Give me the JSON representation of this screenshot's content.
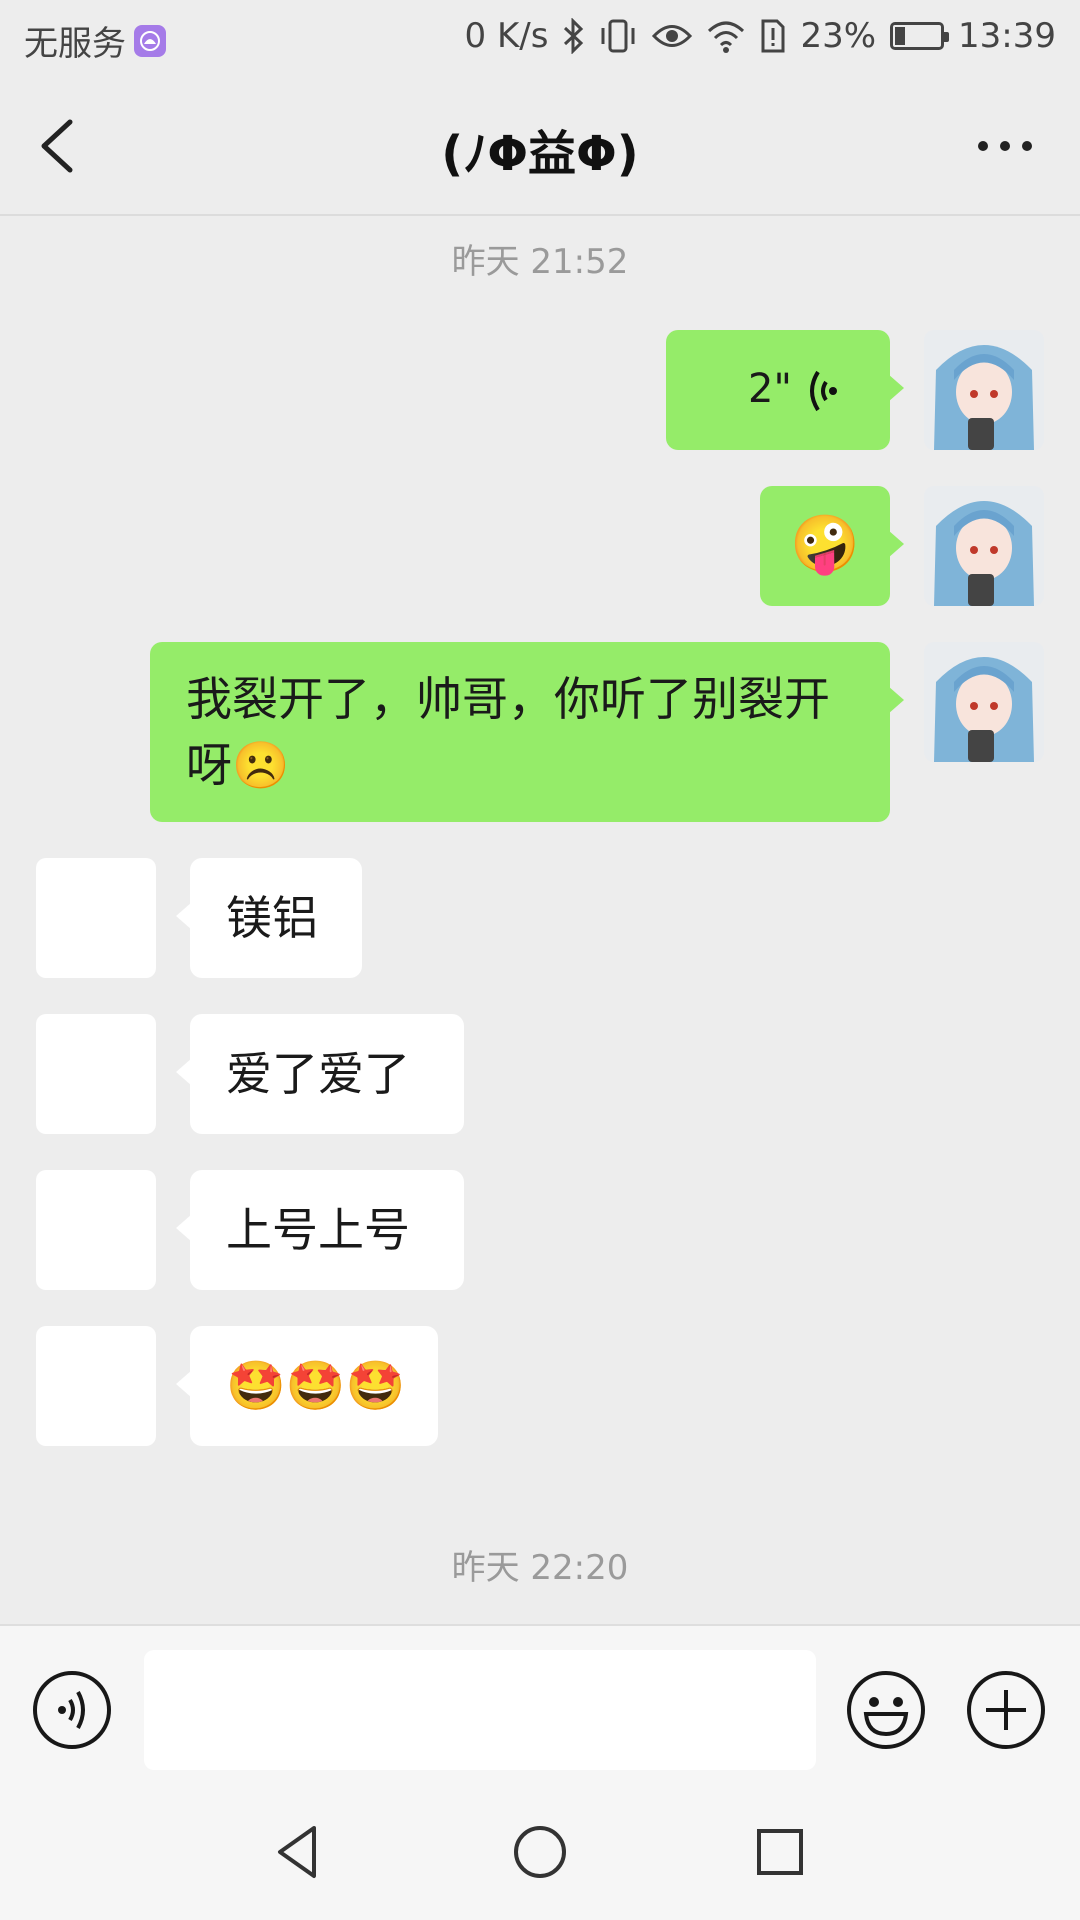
{
  "status_bar": {
    "carrier": "无服务",
    "net_speed": "0 K/s",
    "battery_percent": "23%",
    "battery_level": 0.23,
    "time": "13:39"
  },
  "header": {
    "title": "(ﾉΦ益Φ)"
  },
  "timestamps": [
    "昨天 21:52",
    "昨天 22:20"
  ],
  "messages": {
    "m1": {
      "type": "voice",
      "duration": "2\""
    },
    "m2": {
      "type": "emoji",
      "text": "🤪"
    },
    "m3": {
      "text": "我裂开了，帅哥，你听了别裂开呀☹️"
    },
    "m4": {
      "text": "镁铝"
    },
    "m5": {
      "text": "爱了爱了"
    },
    "m6": {
      "text": "上号上号"
    },
    "m7": {
      "text": "🤩🤩🤩"
    }
  },
  "input": {
    "value": "",
    "placeholder": ""
  },
  "icons": {
    "back": "back-arrow-icon",
    "more": "more-dots-icon",
    "voice": "voice-input-icon",
    "emoji": "emoji-face-icon",
    "plus": "plus-icon",
    "nav_back": "nav-back-triangle-icon",
    "nav_home": "nav-home-circle-icon",
    "nav_recent": "nav-recent-square-icon"
  },
  "colors": {
    "background": "#ededed",
    "my_bubble": "#95ec69",
    "their_bubble": "#ffffff",
    "timestamp": "#9a9a9a"
  }
}
